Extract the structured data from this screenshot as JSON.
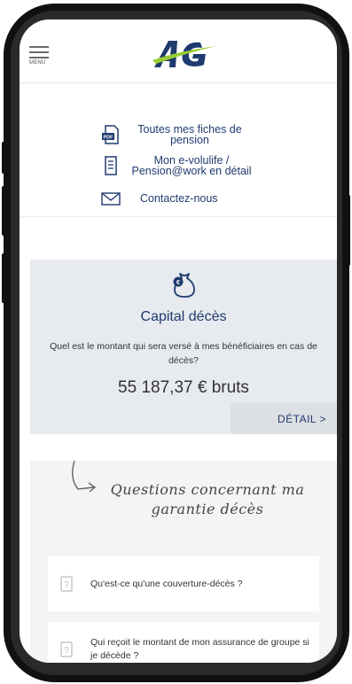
{
  "header": {
    "menu_label": "MENU",
    "logo_text": "AG"
  },
  "links": [
    {
      "label": "Toutes mes fiches de pension",
      "icon": "pdf-icon"
    },
    {
      "label": "Mon e-volulife / Pension@work en détail",
      "icon": "document-icon"
    },
    {
      "label": "Contactez-nous",
      "icon": "envelope-icon"
    }
  ],
  "capital_card": {
    "icon": "money-bag-icon",
    "title": "Capital décès",
    "description": "Quel est le montant qui sera versé à mes bénéficiaires en cas de décès?",
    "amount": "55 187,37 € bruts",
    "detail_label": "DÉTAIL  >"
  },
  "faq": {
    "title": "Questions concernant ma garantie décès",
    "questions": [
      {
        "text": "Qu'est-ce qu'une couverture-décès ?"
      },
      {
        "text": "Qui reçoit le montant de mon assurance de groupe si je décède ?"
      }
    ]
  },
  "colors": {
    "brand_blue": "#1f3a6e",
    "brand_green": "#9acd32",
    "card_bg": "#e7eaee"
  }
}
